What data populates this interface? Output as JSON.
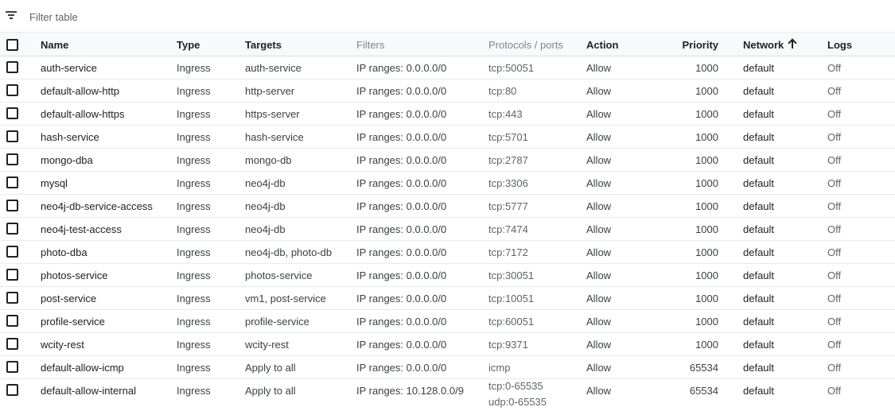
{
  "filter": {
    "placeholder": "Filter table",
    "icon": "filter-list-icon"
  },
  "columns": {
    "name": "Name",
    "type": "Type",
    "targets": "Targets",
    "filters": "Filters",
    "protocols": "Protocols / ports",
    "action": "Action",
    "priority": "Priority",
    "network": "Network",
    "logs": "Logs"
  },
  "sort": {
    "column": "network",
    "direction": "ascending",
    "icon": "arrow-upward-icon"
  },
  "rows": [
    {
      "name": "auth-service",
      "type": "Ingress",
      "targets": "auth-service",
      "filters": "IP ranges: 0.0.0.0/0",
      "protocols": [
        "tcp:50051"
      ],
      "action": "Allow",
      "priority": "1000",
      "network": "default",
      "logs": "Off"
    },
    {
      "name": "default-allow-http",
      "type": "Ingress",
      "targets": "http-server",
      "filters": "IP ranges: 0.0.0.0/0",
      "protocols": [
        "tcp:80"
      ],
      "action": "Allow",
      "priority": "1000",
      "network": "default",
      "logs": "Off"
    },
    {
      "name": "default-allow-https",
      "type": "Ingress",
      "targets": "https-server",
      "filters": "IP ranges: 0.0.0.0/0",
      "protocols": [
        "tcp:443"
      ],
      "action": "Allow",
      "priority": "1000",
      "network": "default",
      "logs": "Off"
    },
    {
      "name": "hash-service",
      "type": "Ingress",
      "targets": "hash-service",
      "filters": "IP ranges: 0.0.0.0/0",
      "protocols": [
        "tcp:5701"
      ],
      "action": "Allow",
      "priority": "1000",
      "network": "default",
      "logs": "Off"
    },
    {
      "name": "mongo-dba",
      "type": "Ingress",
      "targets": "mongo-db",
      "filters": "IP ranges: 0.0.0.0/0",
      "protocols": [
        "tcp:2787"
      ],
      "action": "Allow",
      "priority": "1000",
      "network": "default",
      "logs": "Off"
    },
    {
      "name": "mysql",
      "type": "Ingress",
      "targets": "neo4j-db",
      "filters": "IP ranges: 0.0.0.0/0",
      "protocols": [
        "tcp:3306"
      ],
      "action": "Allow",
      "priority": "1000",
      "network": "default",
      "logs": "Off"
    },
    {
      "name": "neo4j-db-service-access",
      "type": "Ingress",
      "targets": "neo4j-db",
      "filters": "IP ranges: 0.0.0.0/0",
      "protocols": [
        "tcp:5777"
      ],
      "action": "Allow",
      "priority": "1000",
      "network": "default",
      "logs": "Off"
    },
    {
      "name": "neo4j-test-access",
      "type": "Ingress",
      "targets": "neo4j-db",
      "filters": "IP ranges: 0.0.0.0/0",
      "protocols": [
        "tcp:7474"
      ],
      "action": "Allow",
      "priority": "1000",
      "network": "default",
      "logs": "Off"
    },
    {
      "name": "photo-dba",
      "type": "Ingress",
      "targets": "neo4j-db, photo-db",
      "filters": "IP ranges: 0.0.0.0/0",
      "protocols": [
        "tcp:7172"
      ],
      "action": "Allow",
      "priority": "1000",
      "network": "default",
      "logs": "Off"
    },
    {
      "name": "photos-service",
      "type": "Ingress",
      "targets": "photos-service",
      "filters": "IP ranges: 0.0.0.0/0",
      "protocols": [
        "tcp:30051"
      ],
      "action": "Allow",
      "priority": "1000",
      "network": "default",
      "logs": "Off"
    },
    {
      "name": "post-service",
      "type": "Ingress",
      "targets": "vm1, post-service",
      "filters": "IP ranges: 0.0.0.0/0",
      "protocols": [
        "tcp:10051"
      ],
      "action": "Allow",
      "priority": "1000",
      "network": "default",
      "logs": "Off"
    },
    {
      "name": "profile-service",
      "type": "Ingress",
      "targets": "profile-service",
      "filters": "IP ranges: 0.0.0.0/0",
      "protocols": [
        "tcp:60051"
      ],
      "action": "Allow",
      "priority": "1000",
      "network": "default",
      "logs": "Off"
    },
    {
      "name": "wcity-rest",
      "type": "Ingress",
      "targets": "wcity-rest",
      "filters": "IP ranges: 0.0.0.0/0",
      "protocols": [
        "tcp:9371"
      ],
      "action": "Allow",
      "priority": "1000",
      "network": "default",
      "logs": "Off"
    },
    {
      "name": "default-allow-icmp",
      "type": "Ingress",
      "targets": "Apply to all",
      "filters": "IP ranges: 0.0.0.0/0",
      "protocols": [
        "icmp"
      ],
      "action": "Allow",
      "priority": "65534",
      "network": "default",
      "logs": "Off"
    },
    {
      "name": "default-allow-internal",
      "type": "Ingress",
      "targets": "Apply to all",
      "filters": "IP ranges: 10.128.0.0/9",
      "protocols": [
        "tcp:0-65535",
        "udp:0-65535"
      ],
      "action": "Allow",
      "priority": "65534",
      "network": "default",
      "logs": "Off"
    }
  ]
}
